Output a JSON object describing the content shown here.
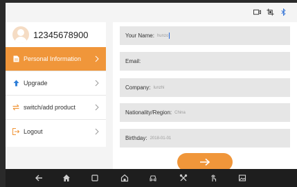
{
  "status_icons": [
    "video-icon",
    "screenshot-icon",
    "bluetooth-icon"
  ],
  "profile": {
    "avatar": "avatar-icon",
    "username": "12345678900"
  },
  "sidebar": {
    "items": [
      {
        "label": "Personal Information",
        "icon": "document-icon",
        "active": true
      },
      {
        "label": "Upgrade",
        "icon": "arrow-up-icon",
        "active": false
      },
      {
        "label": "switch/add product",
        "icon": "switch-icon",
        "active": false
      },
      {
        "label": "Logout",
        "icon": "logout-icon",
        "active": false
      }
    ]
  },
  "form": {
    "fields": [
      {
        "label": "Your Name:",
        "value": "hunzo"
      },
      {
        "label": "Email:",
        "value": ""
      },
      {
        "label": "Company:",
        "value": "Iunzhi"
      },
      {
        "label": "Nationality/Region:",
        "value": "China"
      },
      {
        "label": "Birthday:",
        "value": "2018-01-01"
      }
    ],
    "next_icon": "arrow-right-icon"
  },
  "navbar": {
    "icons": [
      "back-icon",
      "home-icon",
      "recent-apps-icon",
      "app-home-icon",
      "car-icon",
      "tools-icon",
      "touch-icon",
      "gallery-icon"
    ]
  },
  "colors": {
    "accent": "#f0963a",
    "field_bg": "#e6e6e6",
    "navbar_bg": "#1e1e1e"
  }
}
